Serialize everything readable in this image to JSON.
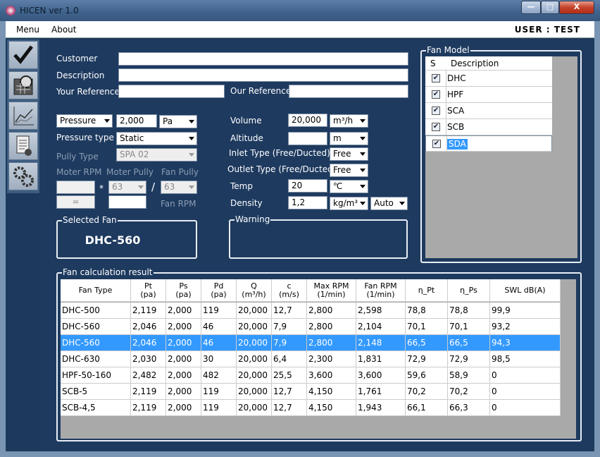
{
  "window": {
    "title": "HICEN ver 1.0",
    "min": "—",
    "max": "□",
    "close": "X"
  },
  "menu": {
    "items": [
      "Menu",
      "About"
    ],
    "user": "USER : TEST"
  },
  "form": {
    "customer_label": "Customer",
    "description_label": "Description",
    "your_ref_label": "Your Reference",
    "our_ref_label": "Our Reference",
    "pressure_select": "Pressure",
    "pressure_value": "2,000",
    "pressure_unit": "Pa",
    "pressure_type_label": "Pressure type",
    "pressure_type": "Static",
    "pully_type_label": "Pully Type",
    "pully_type": "SPA 02",
    "moter_rpm_label": "Moter RPM",
    "moter_pully_label": "Moter Pully",
    "fan_pully_label": "Fan Pully",
    "moter_pully": "63",
    "fan_pully": "63",
    "star": "*",
    "slash": "/",
    "equals": "=",
    "fan_rpm_label": "Fan RPM",
    "volume_label": "Volume",
    "volume_value": "20,000",
    "volume_unit": "m³/h",
    "altitude_label": "Altitude",
    "altitude_unit": "m",
    "inlet_label": "Inlet Type (Free/Ducted)",
    "inlet_value": "Free",
    "outlet_label": "Outlet Type (Free/Ducted)",
    "outlet_value": "Free",
    "temp_label": "Temp",
    "temp_value": "20",
    "temp_unit": "℃",
    "density_label": "Density",
    "density_value": "1,2",
    "density_unit": "kg/m³",
    "density_mode": "Auto"
  },
  "selected_fan": {
    "label": "Selected Fan",
    "value": "DHC-560"
  },
  "warning": {
    "label": "Warning"
  },
  "fan_model": {
    "label": "Fan Model",
    "col_s": "S",
    "col_desc": "Description",
    "items": [
      {
        "name": "DHC",
        "checked": "✔"
      },
      {
        "name": "HPF",
        "checked": "✔"
      },
      {
        "name": "SCA",
        "checked": "✔"
      },
      {
        "name": "SCB",
        "checked": "✔"
      },
      {
        "name": "SDA",
        "checked": "✔"
      }
    ]
  },
  "result": {
    "label": "Fan calculation result",
    "headers": [
      [
        "Fan Type",
        ""
      ],
      [
        "Pt",
        "(pa)"
      ],
      [
        "Ps",
        "(pa)"
      ],
      [
        "Pd",
        "(pa)"
      ],
      [
        "Q",
        "(m³/h)"
      ],
      [
        "c",
        "(m/s)"
      ],
      [
        "Max RPM",
        "(1/min)"
      ],
      [
        "Fan RPM",
        "(1/min)"
      ],
      [
        "η_Pt",
        ""
      ],
      [
        "η_Ps",
        ""
      ],
      [
        "SWL dB(A)",
        ""
      ]
    ],
    "rows": [
      [
        "DHC-500",
        "2,119",
        "2,000",
        "119",
        "20,000",
        "12,7",
        "2,800",
        "2,598",
        "78,8",
        "78,8",
        "99,9"
      ],
      [
        "DHC-560",
        "2,046",
        "2,000",
        "46",
        "20,000",
        "7,9",
        "2,800",
        "2,104",
        "70,1",
        "70,1",
        "93,2"
      ],
      [
        "DHC-560",
        "2,046",
        "2,000",
        "46",
        "20,000",
        "7,9",
        "2,800",
        "2,148",
        "66,5",
        "66,5",
        "94,3"
      ],
      [
        "DHC-630",
        "2,030",
        "2,000",
        "30",
        "20,000",
        "6,4",
        "2,300",
        "1,831",
        "72,9",
        "72,9",
        "98,5"
      ],
      [
        "HPF-50-160",
        "2,482",
        "2,000",
        "482",
        "20,000",
        "25,5",
        "3,600",
        "3,600",
        "59,6",
        "58,9",
        "0"
      ],
      [
        "SCB-5",
        "2,119",
        "2,000",
        "119",
        "20,000",
        "12,7",
        "4,150",
        "1,761",
        "70,2",
        "70,2",
        "0"
      ],
      [
        "SCB-4,5",
        "2,119",
        "2,000",
        "119",
        "20,000",
        "12,7",
        "4,150",
        "1,943",
        "66,1",
        "66,3",
        "0"
      ]
    ],
    "selected_row": 2
  }
}
